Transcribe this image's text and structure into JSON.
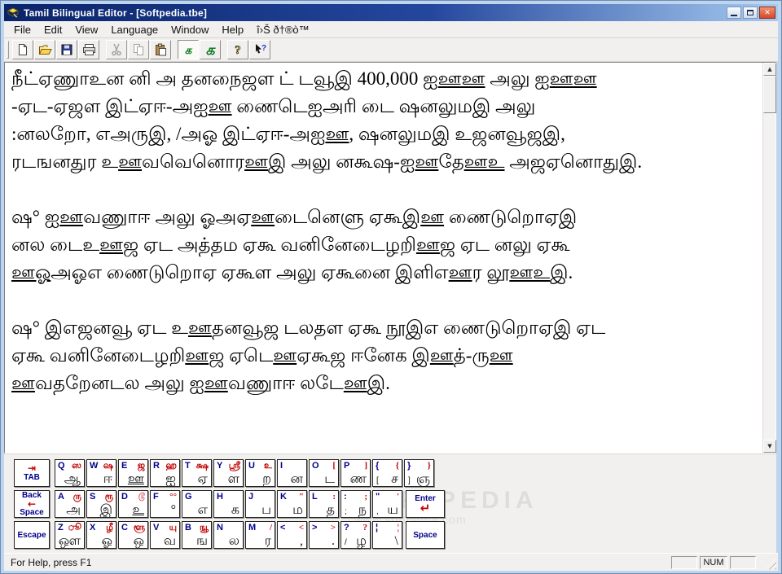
{
  "window": {
    "title": "Tamil Bilingual Editor - [Softpedia.tbe]",
    "controls": {
      "minimize": "minimize",
      "maximize": "maximize",
      "close": "close"
    }
  },
  "colors": {
    "titlebar_start": "#0a246a",
    "titlebar_end": "#a6caf0",
    "key_letter_blue": "#00008b",
    "key_shift_red": "#c00000",
    "toolbar_green": "#0a7a1e",
    "frame_blue": "#bfd5ee"
  },
  "menu": {
    "items": [
      "File",
      "Edit",
      "View",
      "Language",
      "Window",
      "Help",
      "î›Š ð†®ò™"
    ]
  },
  "toolbar": {
    "buttons": [
      {
        "name": "new",
        "icon": "new-icon",
        "enabled": true
      },
      {
        "name": "open",
        "icon": "open-icon",
        "enabled": true
      },
      {
        "name": "save",
        "icon": "save-icon",
        "enabled": true
      },
      {
        "name": "print",
        "icon": "print-icon",
        "enabled": true
      },
      {
        "sep": true
      },
      {
        "name": "cut",
        "icon": "cut-icon",
        "enabled": false
      },
      {
        "name": "copy",
        "icon": "copy-icon",
        "enabled": false
      },
      {
        "name": "paste",
        "icon": "paste-icon",
        "enabled": true
      },
      {
        "sep": true
      },
      {
        "name": "tamil-font-small",
        "glyph": "க",
        "size": "small",
        "pressed": true,
        "enabled": true
      },
      {
        "name": "tamil-font-large",
        "glyph": "க",
        "size": "large",
        "enabled": true
      },
      {
        "sep": true
      },
      {
        "name": "help",
        "icon": "help-icon",
        "enabled": true
      },
      {
        "name": "context-help",
        "icon": "context-help-icon",
        "enabled": true
      }
    ]
  },
  "editor": {
    "paragraphs": [
      [
        [
          {
            "t": "நீட்ஏணுாஉன னி அ தனநைஜள ட் டவூஇ 400,000 ஐ"
          },
          {
            "t": "ஊஊ",
            "u": true
          },
          {
            "t": " அலு ஐ"
          },
          {
            "t": "ஊஊ",
            "u": true
          }
        ],
        [
          {
            "t": "-ஏட-ஏஜள இட்ஏஈ-அஐ"
          },
          {
            "t": "ஊ",
            "u": true
          },
          {
            "t": " ணைடெஐஅரி டை ஷனலுமஇ அலு"
          }
        ],
        [
          {
            "t": ":னலறோ, எஅருஇ, /அஓ இட்ஏஈ-அஐ"
          },
          {
            "t": "ஊ",
            "u": true
          },
          {
            "t": ", ஷனலுமஇ உஜனவூஜஇ,"
          }
        ],
        [
          {
            "t": "ரடஙனதுர உ"
          },
          {
            "t": "ஊ",
            "u": true
          },
          {
            "t": "வவெனொர"
          },
          {
            "t": "ஊ",
            "u": true
          },
          {
            "t": "இ அலு னகூஷ-ஐ"
          },
          {
            "t": "ஊ",
            "u": true
          },
          {
            "t": "தே"
          },
          {
            "t": "ஊஉ",
            "u": true
          },
          {
            "t": " அஜஏனொதுஇ."
          }
        ]
      ],
      [
        [
          {
            "t": "ஷ° ஐ"
          },
          {
            "t": "ஊ",
            "u": true
          },
          {
            "t": "வணுாஈ அலு ஓஅஏ"
          },
          {
            "t": "ஊ",
            "u": true
          },
          {
            "t": "டைனெளு ஏகூஇ"
          },
          {
            "t": "ஊ",
            "u": true
          },
          {
            "t": " ணைடுறொஏஇ"
          }
        ],
        [
          {
            "t": "னல டைஉ"
          },
          {
            "t": "ஊ",
            "u": true
          },
          {
            "t": "ஜ ஏட அத்தம ஏகூ வனினேடைழறி"
          },
          {
            "t": "ஊ",
            "u": true
          },
          {
            "t": "ஜ ஏட னலு ஏகூ"
          }
        ],
        [
          {
            "t": "ஊஓ",
            "u": true
          },
          {
            "t": "அஓஎ ணைடுறொஏ ஏகூள அலு ஏகூனை இளிஎ"
          },
          {
            "t": "ஊ",
            "u": true
          },
          {
            "t": "ர லூ"
          },
          {
            "t": "ஊஉ",
            "u": true
          },
          {
            "t": "இ."
          }
        ]
      ],
      [
        [
          {
            "t": "ஷ° இஎஜனவூ ஏட உ"
          },
          {
            "t": "ஊ",
            "u": true
          },
          {
            "t": "தனவூஜ டலதள ஏகூ நூஇஎ ணைடுறொஏஇ ஏட"
          }
        ],
        [
          {
            "t": "ஏகூ வனினேடைழறி"
          },
          {
            "t": "ஊ",
            "u": true
          },
          {
            "t": "ஜ ஏடெ"
          },
          {
            "t": "ஊ",
            "u": true
          },
          {
            "t": "ஏகூஜ ஈனேக இ"
          },
          {
            "t": "ஊ",
            "u": true
          },
          {
            "t": "த்-ரு"
          },
          {
            "t": "ஊ",
            "u": true
          }
        ],
        [
          {
            "t": "ஊ",
            "u": true
          },
          {
            "t": "வதறேனடல அலு ஐ"
          },
          {
            "t": "ஊ",
            "u": true
          },
          {
            "t": "வணுாஈ லடே"
          },
          {
            "t": "ஊ",
            "u": true
          },
          {
            "t": "இ."
          }
        ]
      ]
    ]
  },
  "keyboard": {
    "rows": [
      [
        {
          "special": "tab",
          "label": "TAB"
        },
        {
          "k": "Q",
          "s": "ஸ",
          "t": "ஆ"
        },
        {
          "k": "W",
          "s": "ஷ",
          "t": "ஈ"
        },
        {
          "k": "E",
          "s": "ஜ",
          "t": "ஊ",
          "tu": true
        },
        {
          "k": "R",
          "s": "ஹ",
          "t": "ஐ"
        },
        {
          "k": "T",
          "s": "க்ஷ",
          "t": "ஏ"
        },
        {
          "k": "Y",
          "s": "ஸ்ரீ",
          "t": "ள"
        },
        {
          "k": "U",
          "s": "உ",
          "t": "ற"
        },
        {
          "k": "I",
          "t": "ன"
        },
        {
          "k": "O",
          "s": "[",
          "t": "ட"
        },
        {
          "k": "P",
          "s": "]",
          "t": "ண"
        },
        {
          "k": "{",
          "s": "{",
          "p": "[",
          "t": "ச"
        },
        {
          "k": "}",
          "s": "}",
          "p": "]",
          "t": "ஞ"
        }
      ],
      [
        {
          "special": "backspace",
          "label": "Back Space"
        },
        {
          "k": "A",
          "s": "ரு",
          "t": "அ"
        },
        {
          "k": "S",
          "s": "ரூ",
          "t": "இ"
        },
        {
          "k": "D",
          "s": "டூ",
          "t": "உ",
          "tu": true
        },
        {
          "k": "F",
          "s": "°°",
          "t": "°"
        },
        {
          "k": "G",
          "t": "எ"
        },
        {
          "k": "H",
          "t": "க"
        },
        {
          "k": "J",
          "t": "ப"
        },
        {
          "k": "K",
          "s": "\"",
          "t": "ம"
        },
        {
          "k": "L",
          "s": ":",
          "t": "த"
        },
        {
          "k": ":",
          "s": ";",
          "p": ";",
          "t": "ந"
        },
        {
          "k": "\"",
          "s": "'",
          "p": ",",
          "t": "ய"
        },
        {
          "special": "enter",
          "label": "Enter"
        }
      ],
      [
        {
          "special": "escape",
          "label": "Escape"
        },
        {
          "k": "Z",
          "s": "ூ",
          "t": "ஔ"
        },
        {
          "k": "X",
          "s": "ழீ",
          "t": "ஓ"
        },
        {
          "k": "C",
          "s": "ளூ",
          "t": "ஒ"
        },
        {
          "k": "V",
          "s": "யு",
          "t": "வ"
        },
        {
          "k": "B",
          "s": "ஙூ",
          "t": "ங"
        },
        {
          "k": "N",
          "t": "ல"
        },
        {
          "k": "M",
          "s": "/",
          "t": "ர"
        },
        {
          "k": "<",
          "s": "<",
          "t": ","
        },
        {
          "k": ">",
          "s": ">",
          "t": "."
        },
        {
          "k": "?",
          "s": "?",
          "p": "/",
          "t": "ழ"
        },
        {
          "k": "¦",
          "s": "¦",
          "t": "\\"
        },
        {
          "special": "space",
          "label": "Space"
        }
      ]
    ]
  },
  "watermark": {
    "line1": "SOFTPEDIA",
    "line2": "www.softpedia.com"
  },
  "statusbar": {
    "message": "For Help, press F1",
    "cells": [
      "",
      "NUM",
      ""
    ]
  }
}
